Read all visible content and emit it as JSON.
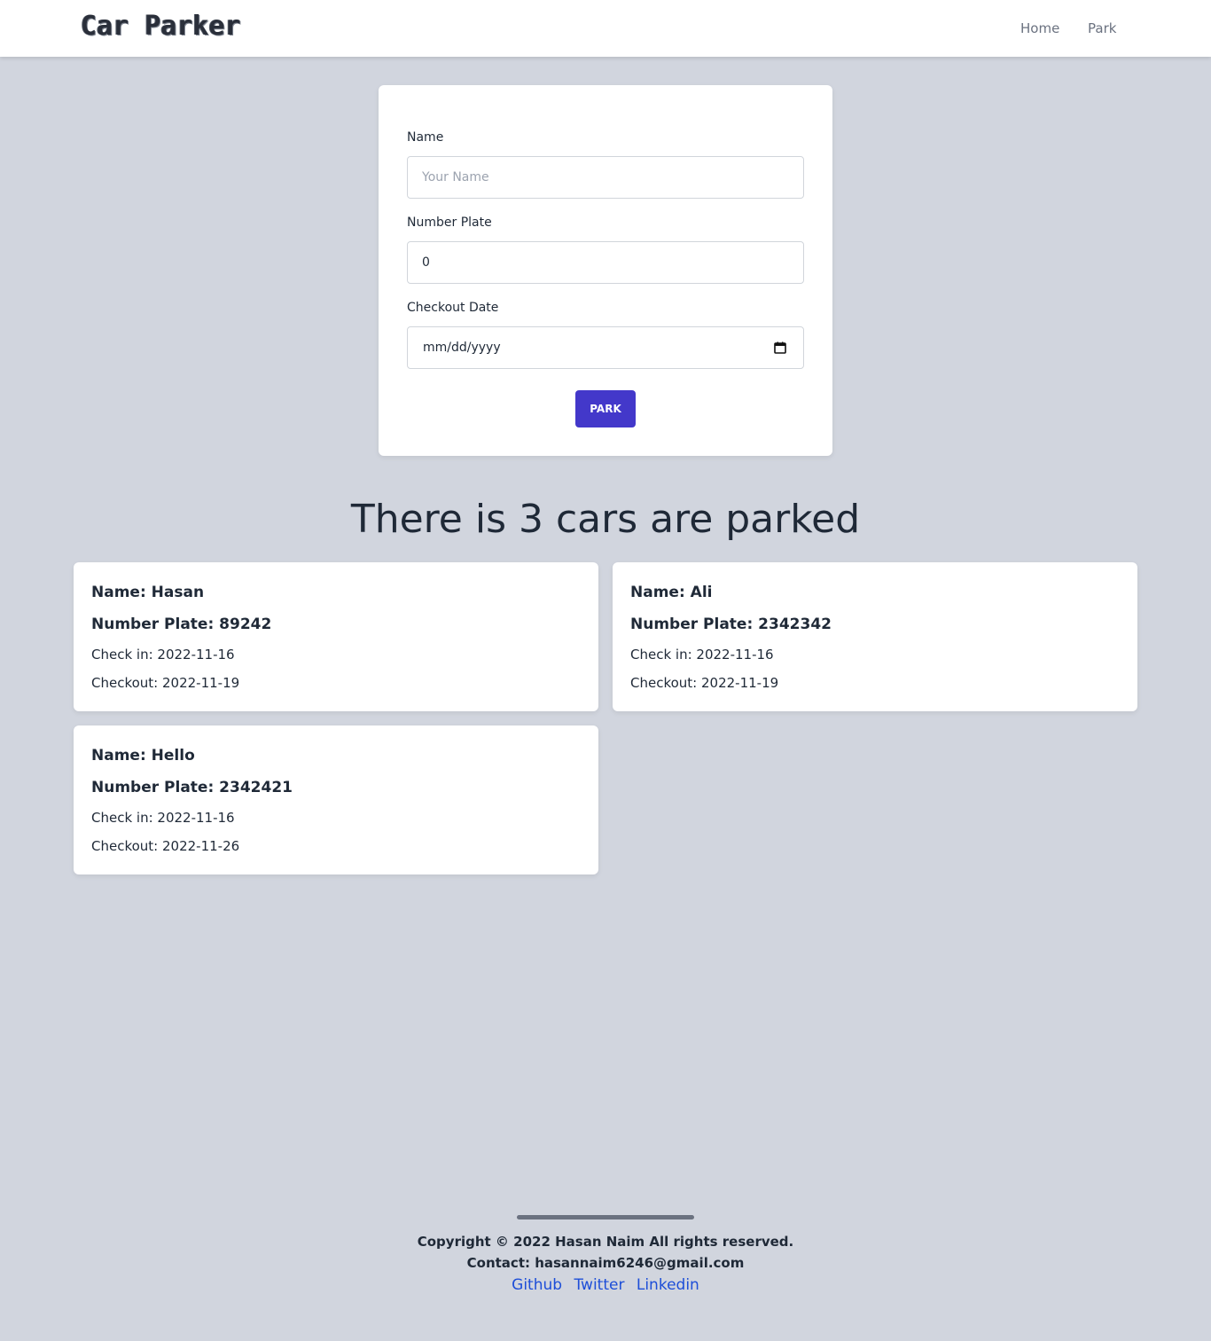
{
  "nav": {
    "logo": "Car Parker",
    "links": [
      "Home",
      "Park"
    ]
  },
  "form": {
    "name_label": "Name",
    "name_placeholder": "Your Name",
    "plate_label": "Number Plate",
    "plate_value": "0",
    "date_label": "Checkout Date",
    "date_placeholder": "mm/dd/yyyy",
    "submit_label": "PARK"
  },
  "heading": "There is 3 cars are parked",
  "cars": [
    {
      "name": "Name: Hasan",
      "plate": "Number Plate: 89242",
      "checkin": "Check in: 2022-11-16",
      "checkout": "Checkout: 2022-11-19"
    },
    {
      "name": "Name: Ali",
      "plate": "Number Plate: 2342342",
      "checkin": "Check in: 2022-11-16",
      "checkout": "Checkout: 2022-11-19"
    },
    {
      "name": "Name: Hello",
      "plate": "Number Plate: 2342421",
      "checkin": "Check in: 2022-11-16",
      "checkout": "Checkout: 2022-11-26"
    }
  ],
  "footer": {
    "copyright": "Copyright © 2022 Hasan Naim All rights reserved.",
    "contact": "Contact: hasannaim6246@gmail.com",
    "links": [
      "Github",
      "Twitter",
      "Linkedin"
    ]
  },
  "colors": {
    "accent": "#4338ca",
    "background": "#d1d5de",
    "link": "#1d4ed8"
  }
}
